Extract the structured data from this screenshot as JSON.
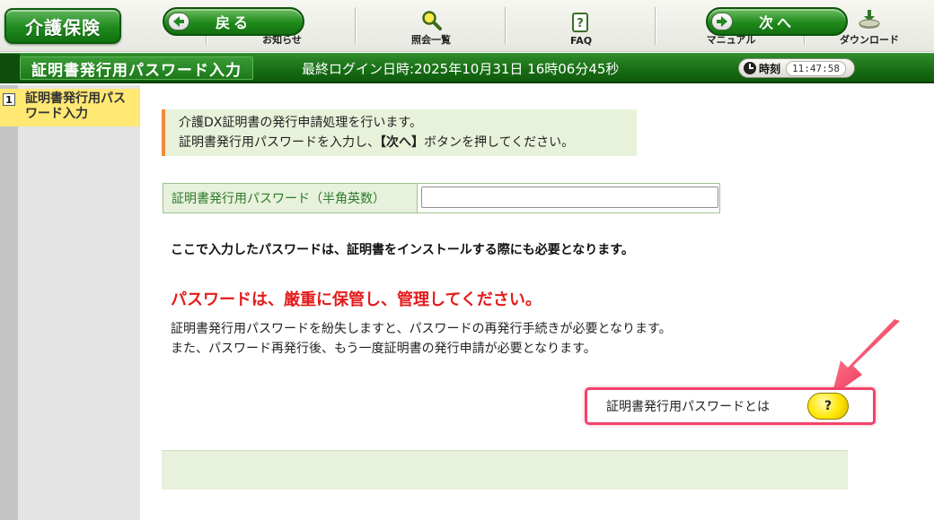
{
  "app": {
    "logo_label": "介護保険"
  },
  "nav": {
    "items": [
      {
        "label": "お知らせ",
        "icon": "info-icon"
      },
      {
        "label": "照会一覧",
        "icon": "search-icon"
      },
      {
        "label": "FAQ",
        "icon": "faq-icon"
      },
      {
        "label": "マニュアル",
        "icon": "manual-icon"
      },
      {
        "label": "ダウンロード",
        "icon": "download-icon"
      }
    ]
  },
  "titlebar": {
    "page_title": "証明書発行用パスワード入力",
    "last_login": "最終ログイン日時:2025年10月31日 16時06分45秒",
    "clock_label": "時刻",
    "clock_time": "11:47:58"
  },
  "sidebar": {
    "steps": [
      {
        "number": "1",
        "label": "証明書発行用パスワード入力"
      }
    ]
  },
  "main": {
    "info_line1": "介護DX証明書の発行申請処理を行います。",
    "info_line2_pre": "証明書発行用パスワードを入力し、",
    "info_line2_btn": "【次へ】",
    "info_line2_post": "ボタンを押してください。",
    "password_label": "証明書発行用パスワード（半角英数）",
    "password_value": "",
    "note_bold": "ここで入力したパスワードは、証明書をインストールする際にも必要となります。",
    "warning_title": "パスワードは、厳重に保管し、管理してください。",
    "warning_line1": "証明書発行用パスワードを紛失しますと、パスワードの再発行手続きが必要となります。",
    "warning_line2": "また、パスワード再発行後、もう一度証明書の発行申請が必要となります。",
    "help_text": "証明書発行用パスワードとは",
    "help_button": "?"
  },
  "footer": {
    "back_label": "戻る",
    "next_label": "次へ"
  },
  "colors": {
    "brand_green": "#1f8a1b",
    "warning_red": "#e31b1b",
    "highlight_pink": "#f2426a",
    "step_yellow": "#ffe873"
  }
}
